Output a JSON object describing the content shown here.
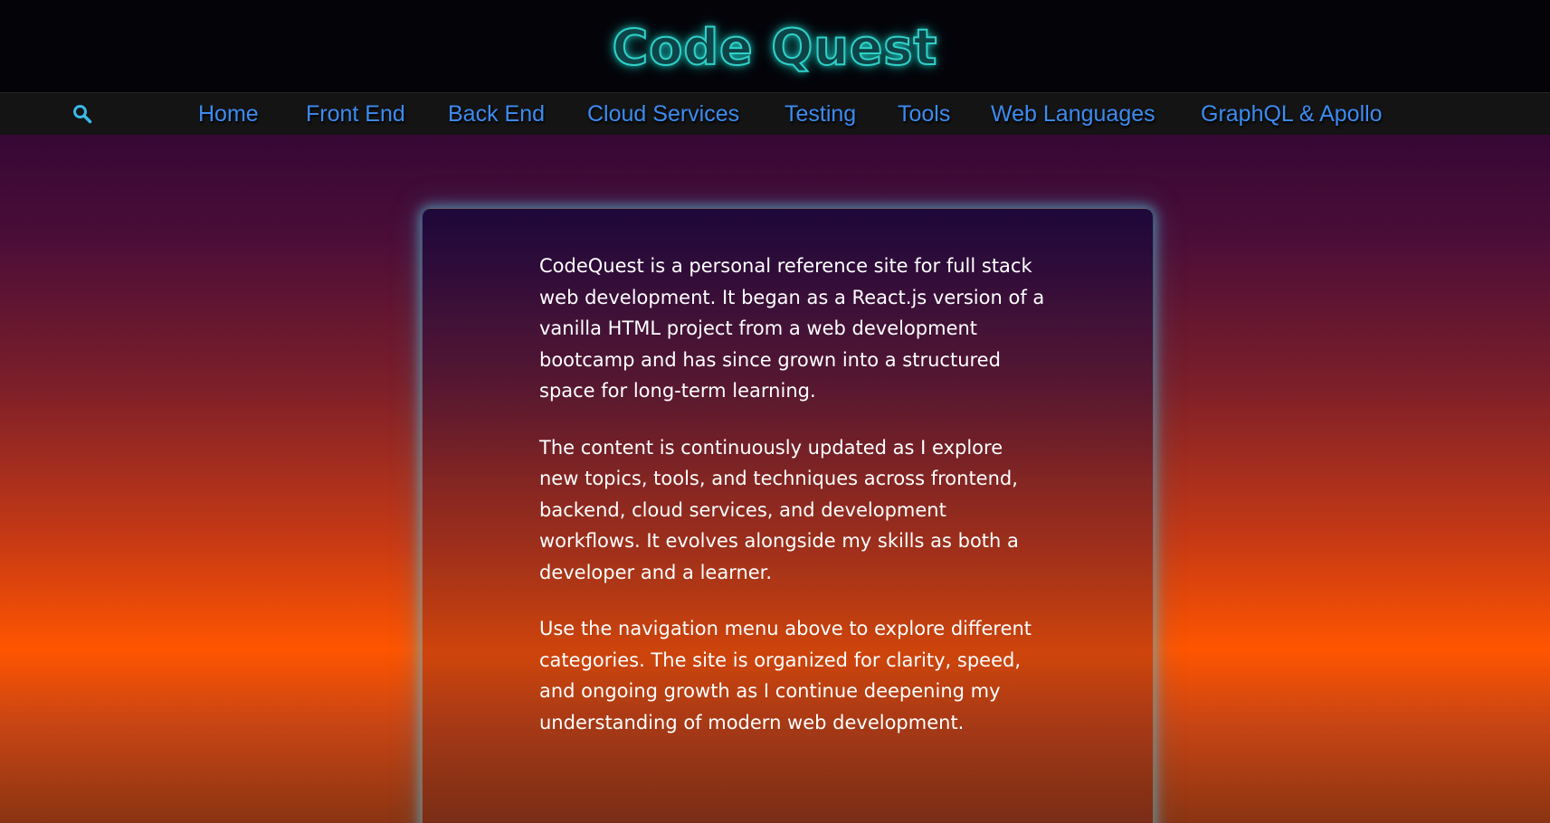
{
  "header": {
    "title": "Code Quest"
  },
  "nav": {
    "search_icon": "search-icon",
    "links": [
      {
        "label": "Home"
      },
      {
        "label": "Front End"
      },
      {
        "label": "Back End"
      },
      {
        "label": "Cloud Services"
      },
      {
        "label": "Testing"
      },
      {
        "label": "Tools"
      },
      {
        "label": "Web Languages"
      },
      {
        "label": "GraphQL & Apollo"
      }
    ]
  },
  "intro": {
    "paragraphs": [
      "CodeQuest is a personal reference site for full stack web development. It began as a React.js version of a vanilla HTML project from a web development bootcamp and has since grown into a structured space for long-term learning.",
      "The content is continuously updated as I explore new topics, tools, and techniques across frontend, backend, cloud services, and development workflows. It evolves alongside my skills as both a developer and a learner.",
      "Use the navigation menu above to explore different categories. The site is organized for clarity, speed, and ongoing growth as I continue deepening my understanding of modern web development."
    ]
  },
  "colors": {
    "title_glow": "#30d0c8",
    "nav_link": "#3d8bf0",
    "header_bg": "#040308",
    "navbar_bg": "#141414",
    "accent_orange": "#ff5500"
  }
}
